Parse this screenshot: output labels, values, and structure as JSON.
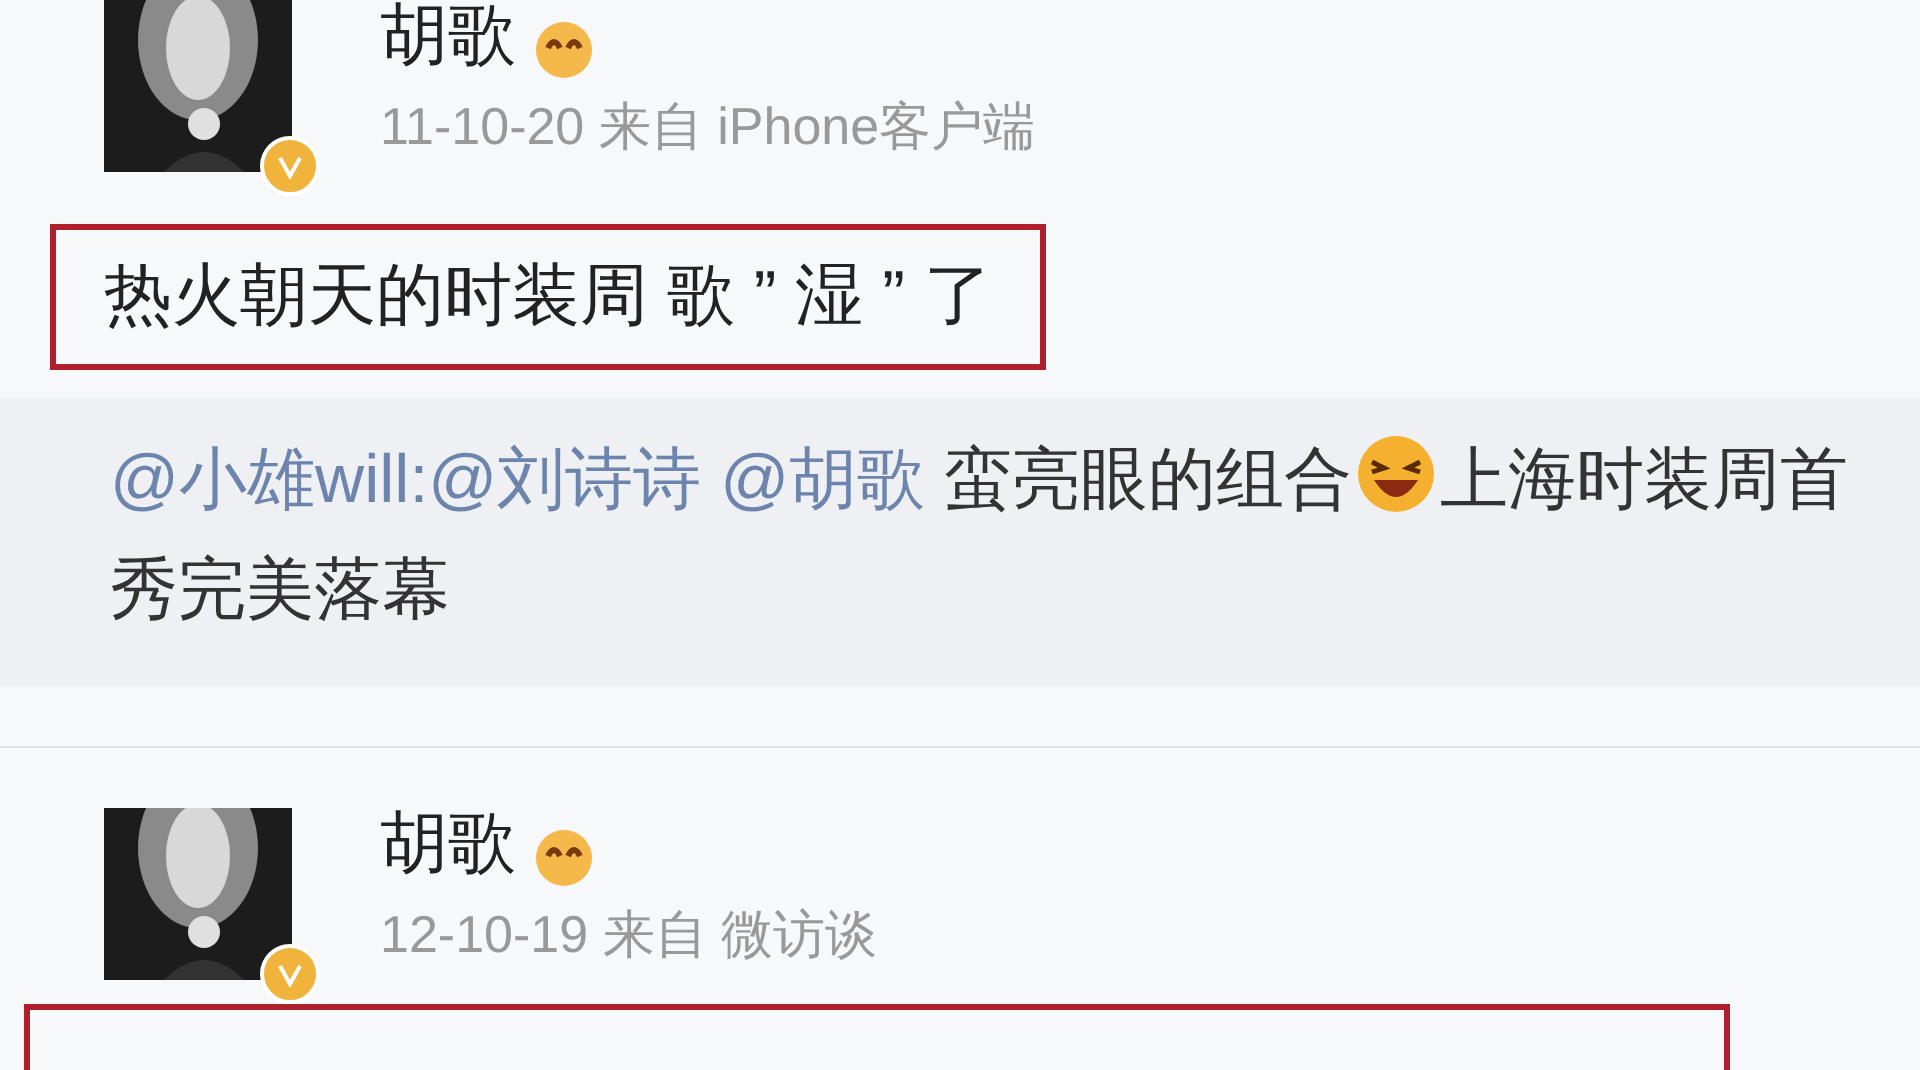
{
  "posts": [
    {
      "author": "胡歌",
      "verified": true,
      "date": "11-10-20",
      "source_prefix": "来自",
      "source": "iPhone客户端",
      "text": "热火朝天的时装周 歌 ” 湿 ” 了",
      "highlighted": true,
      "repost": [
        {
          "kind": "mention",
          "text": "@小雄will:@刘诗诗"
        },
        {
          "kind": "mention",
          "text": "@胡歌"
        },
        {
          "kind": "plain",
          "text": "蛮亮眼的组合"
        },
        {
          "kind": "emoji"
        },
        {
          "kind": "plain",
          "text": "上海时装周首秀完美落幕"
        }
      ]
    },
    {
      "author": "胡歌",
      "verified": true,
      "date": "12-10-19",
      "source_prefix": "来自",
      "source": "微访谈",
      "highlighted": true
    }
  ]
}
